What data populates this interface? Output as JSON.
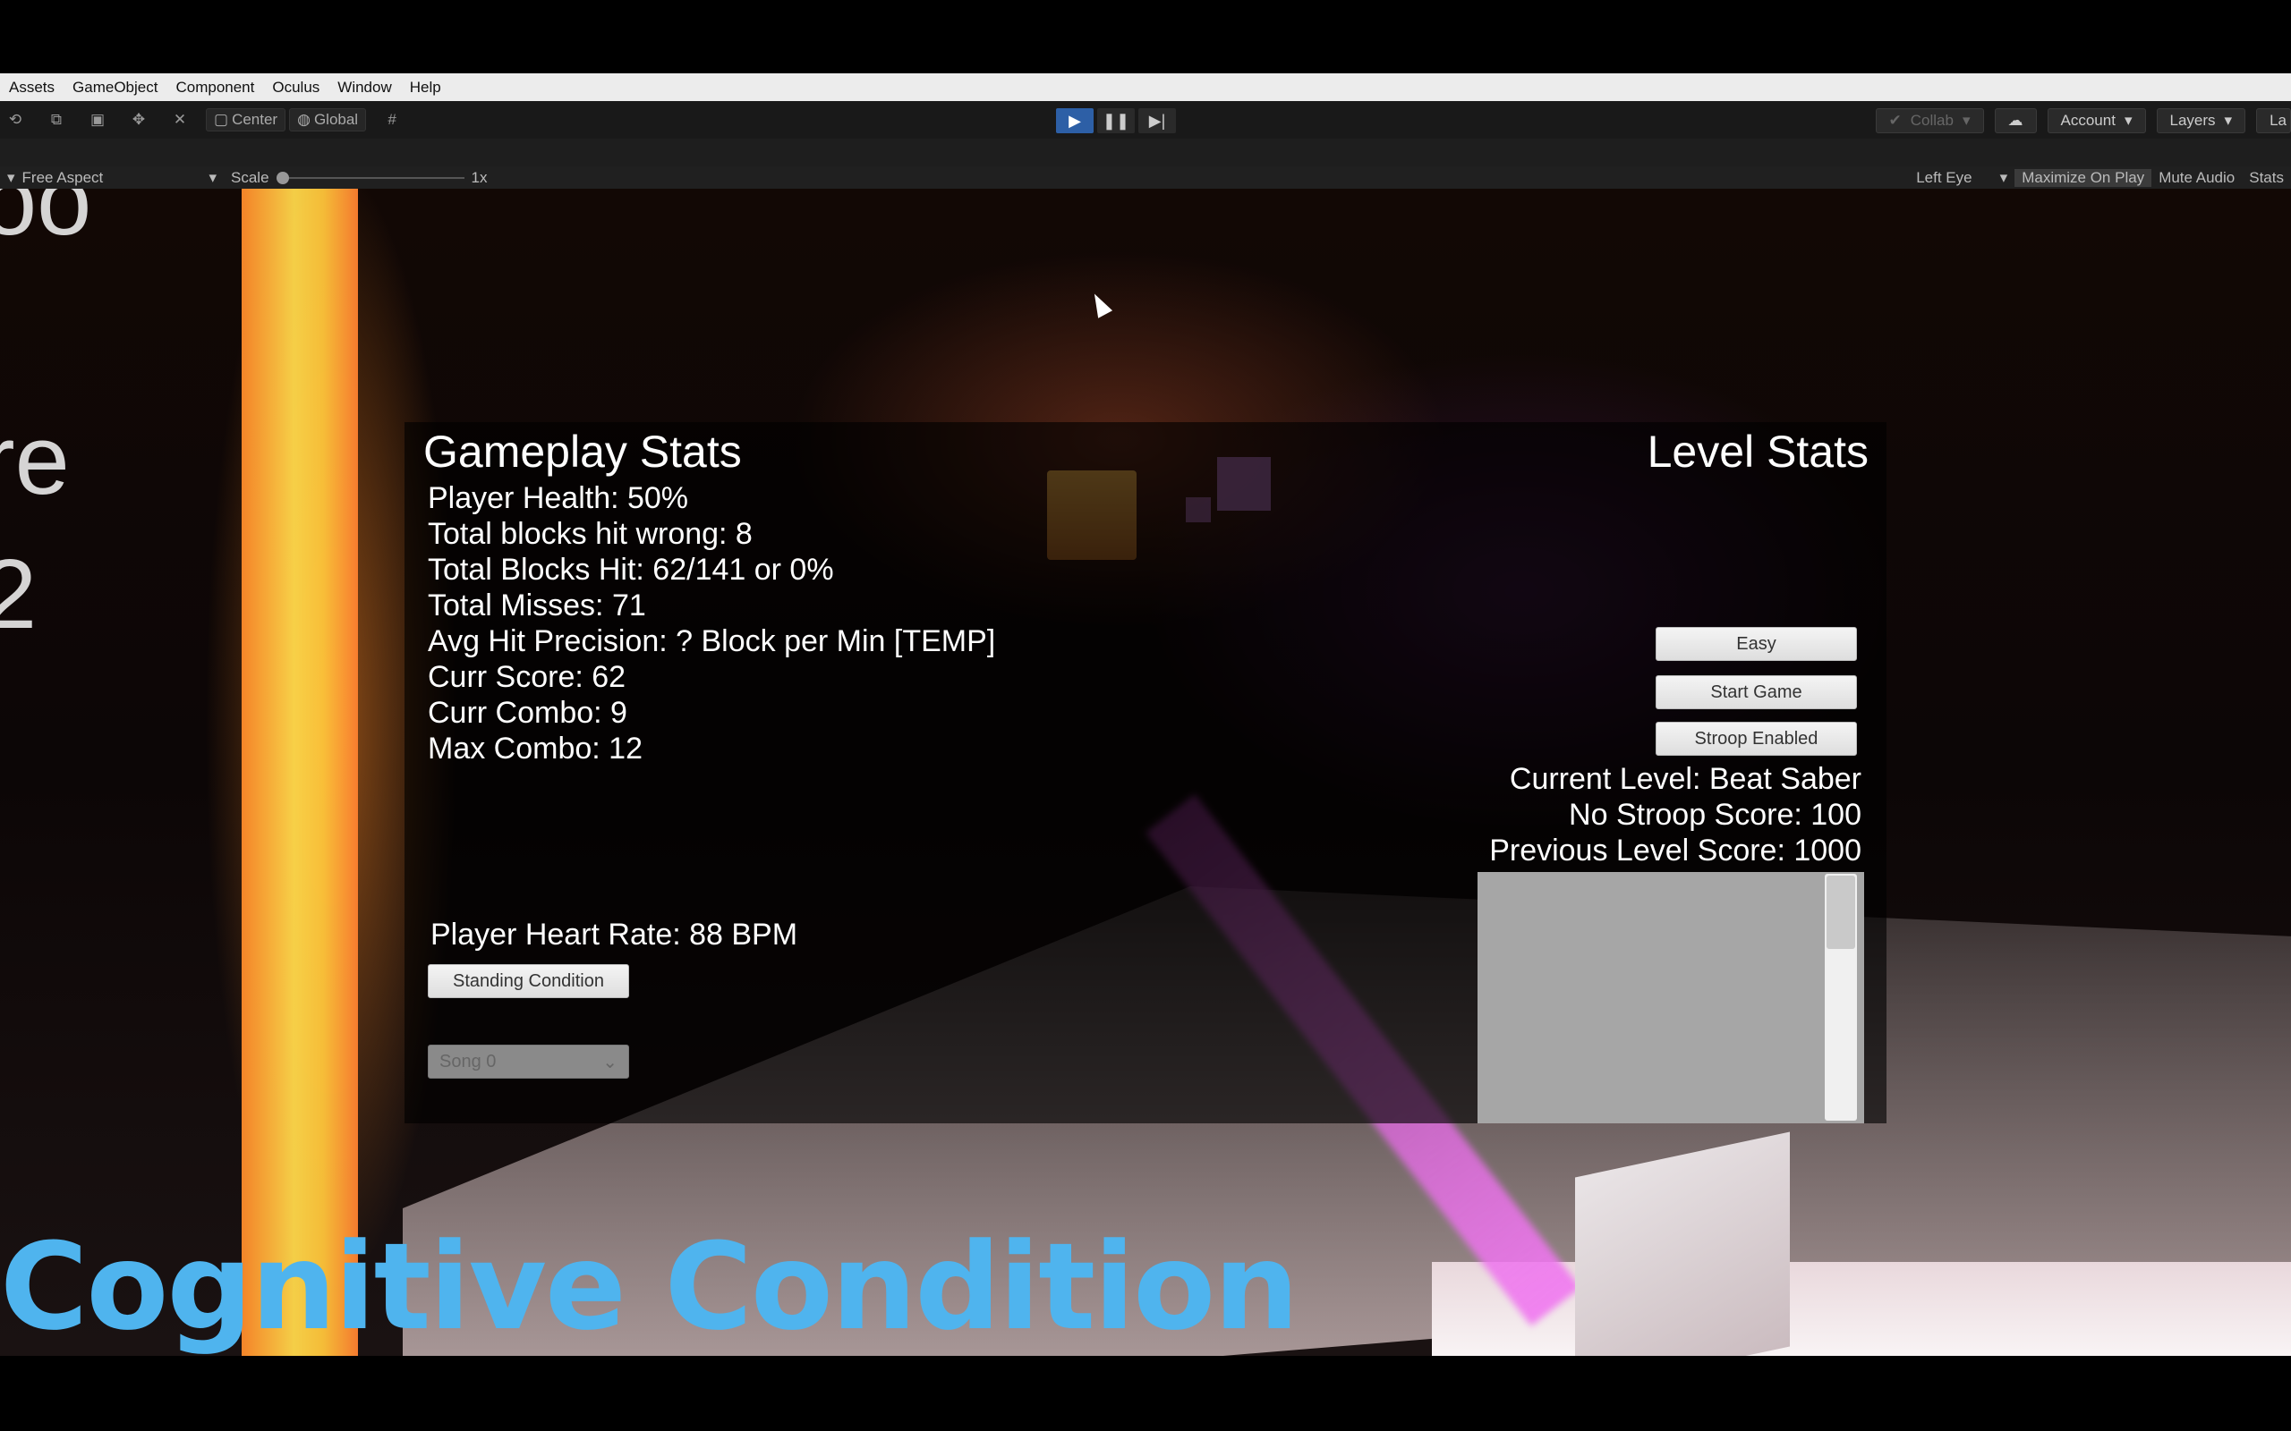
{
  "menubar": {
    "items": [
      "Assets",
      "GameObject",
      "Component",
      "Oculus",
      "Window",
      "Help"
    ]
  },
  "toolbar": {
    "pivot_label": "Center",
    "space_label": "Global",
    "collab_label": "Collab",
    "account_label": "Account",
    "layers_label": "Layers",
    "layout_label": "La"
  },
  "gameview": {
    "aspect_label": "Free Aspect",
    "scale_label": "Scale",
    "scale_value": "1x",
    "eye_label": "Left Eye",
    "maximize_label": "Maximize On Play",
    "mute_label": "Mute Audio",
    "stats_label": "Stats"
  },
  "scene": {
    "partial_text_1": "oo",
    "partial_text_2": "re",
    "partial_text_3": "2",
    "caption": "Cognitive Condition"
  },
  "gameplay": {
    "title": "Gameplay Stats",
    "stats": [
      "Player Health: 50%",
      "Total blocks hit wrong: 8",
      "Total Blocks Hit: 62/141 or 0%",
      "Total Misses: 71",
      "Avg Hit Precision: ? Block per Min [TEMP]",
      "Curr Score: 62",
      "Curr Combo: 9",
      "Max Combo: 12"
    ],
    "heart_rate": "Player Heart Rate: 88 BPM",
    "condition_button": "Standing Condition",
    "song_select": "Song 0"
  },
  "level": {
    "title": "Level Stats",
    "difficulty_button": "Easy",
    "start_button": "Start Game",
    "stroop_button": "Stroop Enabled",
    "current_level": "Current Level: Beat Saber",
    "no_stroop_score": "No Stroop Score: 100",
    "previous_score": "Previous Level Score: 1000"
  },
  "colors": {
    "play_active": "#2d5fa6",
    "caption": "#4fb4ee"
  }
}
